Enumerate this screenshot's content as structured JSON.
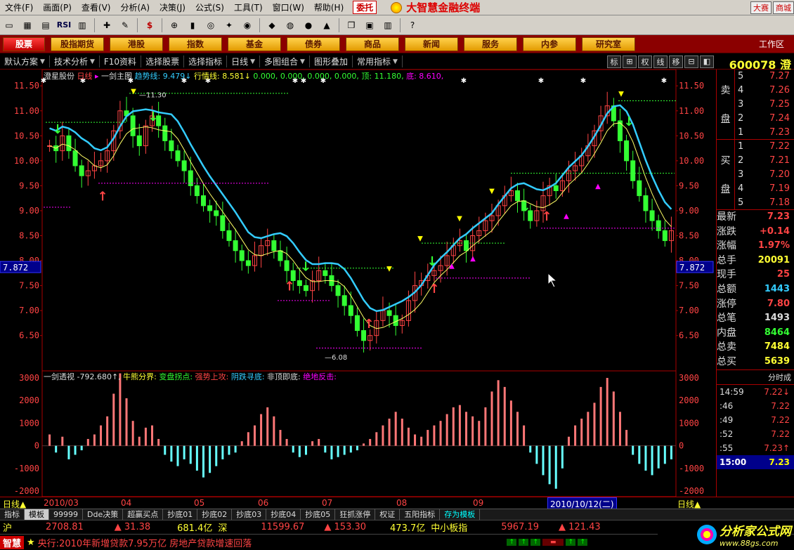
{
  "menu": {
    "items": [
      "文件(F)",
      "画面(P)",
      "查看(V)",
      "分析(A)",
      "决策(J)",
      "公式(S)",
      "工具(T)",
      "窗口(W)",
      "帮助(H)"
    ],
    "weituo": "委托",
    "brand": "大智慧金融终端",
    "right_buttons": [
      "大赛",
      "商城"
    ]
  },
  "toolbar": {
    "rsi_label": "RSI",
    "yuan": "$"
  },
  "nav": {
    "first": "股票",
    "items": [
      "股指期货",
      "港股",
      "指数",
      "基金",
      "债券",
      "商品",
      "新闻",
      "服务",
      "内参",
      "研究室"
    ],
    "work": "工作区"
  },
  "subbar": {
    "items": [
      "默认方案",
      "技术分析",
      "F10资料",
      "选择股票",
      "选择指标",
      "日线",
      "多图组合",
      "图形叠加",
      "常用指标"
    ],
    "controls": [
      "标",
      "⊞",
      "权",
      "线",
      "移",
      "⊟",
      "◧"
    ]
  },
  "stock_code": "600078 澄",
  "legend_main": {
    "name": "澄星股份",
    "period": "日线",
    "formula": "一剑主图",
    "trend_label": "趋势线:",
    "trend_value": "9.479↓",
    "hq_label": "行情线:",
    "hq_value": "8.581↓",
    "zeros": "0.000, 0.000, 0.000, 0.000,",
    "top_label": "顶:",
    "top_value": "11.180,",
    "bottom_label": "底:",
    "bottom_value": "8.610,"
  },
  "legend_sub": {
    "name": "一剑透视",
    "value": "-792.680↑,",
    "items": [
      "牛熊分界:",
      "变盘拐点:",
      "强势上攻:",
      "阴跌寻底:",
      "非顶即底:",
      "绝地反击:"
    ]
  },
  "price_axis": [
    "11.50",
    "11.00",
    "10.50",
    "10.00",
    "9.50",
    "9.00",
    "8.50",
    "8.00",
    "7.50",
    "7.00",
    "6.50"
  ],
  "sub_axis": [
    "3000",
    "2000",
    "1000",
    "0",
    "-1000",
    "-2000"
  ],
  "current_price_tag": "7.872",
  "annotations": {
    "high": "11.30",
    "low": "6.08"
  },
  "order_book": {
    "sell_label": [
      "卖",
      "盘"
    ],
    "buy_label": [
      "买",
      "盘"
    ],
    "sell": [
      {
        "n": "5",
        "p": "7.27"
      },
      {
        "n": "4",
        "p": "7.26"
      },
      {
        "n": "3",
        "p": "7.25"
      },
      {
        "n": "2",
        "p": "7.24"
      },
      {
        "n": "1",
        "p": "7.23"
      }
    ],
    "buy": [
      {
        "n": "1",
        "p": "7.22"
      },
      {
        "n": "2",
        "p": "7.21"
      },
      {
        "n": "3",
        "p": "7.20"
      },
      {
        "n": "4",
        "p": "7.19"
      },
      {
        "n": "5",
        "p": "7.18"
      }
    ]
  },
  "quote": [
    {
      "k": "最新",
      "v": "7.23",
      "c": "#ff4444"
    },
    {
      "k": "涨跌",
      "v": "+0.14",
      "c": "#ff4444"
    },
    {
      "k": "涨幅",
      "v": "1.97%",
      "c": "#ff4444"
    },
    {
      "k": "总手",
      "v": "20091",
      "c": "#ffff33"
    },
    {
      "k": "现手",
      "v": "25",
      "c": "#ff4444"
    },
    {
      "k": "总额",
      "v": "1443",
      "c": "#33ccff"
    },
    {
      "k": "涨停",
      "v": "7.80",
      "c": "#ff4444"
    },
    {
      "k": "总笔",
      "v": "1493",
      "c": "#dddddd"
    },
    {
      "k": "内盘",
      "v": "8464",
      "c": "#33ff33"
    },
    {
      "k": "总卖",
      "v": "7484",
      "c": "#ffff33"
    },
    {
      "k": "总买",
      "v": "5639",
      "c": "#ffff33"
    }
  ],
  "ticks_header": "分时成",
  "ticks": [
    {
      "t": "14:59",
      "p": "7.22↓"
    },
    {
      "t": ":46",
      "p": "7.22"
    },
    {
      "t": ":49",
      "p": "7.22"
    },
    {
      "t": ":52",
      "p": "7.22"
    },
    {
      "t": ":55",
      "p": "7.23↑"
    }
  ],
  "tick_last": {
    "t": "15:00",
    "p": "7.23"
  },
  "date_axis": {
    "left_label": "日线",
    "labels": [
      "2010/03",
      "04",
      "05",
      "06",
      "07",
      "08",
      "09",
      "10"
    ],
    "cursor_date": "2010/10/12(二)",
    "right_label": "日线"
  },
  "tabs": [
    "指标",
    "模板",
    "99999",
    "Dde决策",
    "超赢买点",
    "抄底01",
    "抄底02",
    "抄底03",
    "抄底04",
    "抄底05",
    "狂抓涨停",
    "权证",
    "五阳指标",
    "存为模板"
  ],
  "index_bar": {
    "sh_label": "沪",
    "sh_val": "2708.81",
    "sh_chg": "▲ 31.38",
    "sh_amt": "681.4亿",
    "sz_label": "深",
    "sz_val": "11599.67",
    "sz_chg": "▲ 153.30",
    "sz_amt": "473.7亿",
    "zx_label": "中小板指",
    "zx_val": "5967.19",
    "zx_chg": "▲ 121.43"
  },
  "ticker": {
    "brand": "智慧",
    "text": "央行:2010年新增贷款7.95万亿 房地产贷款增速回落"
  },
  "watermark": {
    "t1": "分析家公式网",
    "t2": "www.88gs.com"
  },
  "colors": {
    "up": "#ff4444",
    "down": "#33ff33",
    "trend": "#33ccff",
    "axis": "#aa0000"
  },
  "chart_data": {
    "type": "candlestick",
    "title": "一剑主图",
    "ylim": [
      6.2,
      11.7
    ],
    "x_labels": [
      "2010/03",
      "04",
      "05",
      "06",
      "07",
      "08",
      "09",
      "10"
    ],
    "close": [
      10.3,
      10.2,
      10.5,
      10.2,
      9.9,
      9.7,
      9.8,
      9.9,
      10.0,
      10.2,
      10.6,
      11.0,
      10.9,
      10.5,
      10.3,
      10.7,
      10.9,
      10.7,
      10.4,
      10.2,
      10.0,
      9.8,
      9.5,
      9.3,
      9.1,
      9.0,
      8.9,
      8.6,
      8.4,
      8.2,
      8.0,
      7.9,
      8.1,
      8.3,
      8.4,
      8.2,
      8.0,
      7.8,
      7.6,
      7.5,
      7.4,
      7.6,
      7.8,
      7.7,
      7.5,
      7.3,
      7.1,
      6.9,
      6.6,
      6.4,
      6.5,
      6.8,
      7.0,
      6.9,
      6.7,
      6.8,
      7.2,
      7.5,
      7.6,
      7.7,
      7.8,
      7.9,
      8.1,
      8.3,
      8.4,
      8.2,
      8.5,
      8.6,
      8.8,
      8.9,
      9.1,
      9.3,
      9.4,
      9.2,
      9.0,
      8.8,
      9.0,
      9.3,
      9.5,
      9.4,
      9.6,
      9.8,
      9.9,
      10.1,
      10.3,
      10.6,
      10.9,
      11.1,
      10.8,
      10.4,
      10.0,
      9.6,
      9.3,
      9.0,
      8.8,
      8.6,
      8.4,
      8.6
    ],
    "volume_indicator": [
      500,
      -300,
      400,
      -600,
      -400,
      -200,
      300,
      500,
      900,
      1300,
      2300,
      3200,
      2100,
      1100,
      400,
      800,
      900,
      300,
      -400,
      -700,
      -900,
      -600,
      -800,
      -1100,
      -1400,
      -1200,
      -900,
      -600,
      -400,
      -300,
      200,
      600,
      900,
      1400,
      1700,
      1300,
      700,
      300,
      -300,
      -500,
      -400,
      200,
      300,
      -300,
      -600,
      -500,
      -400,
      -300,
      -200,
      100,
      300,
      600,
      900,
      1200,
      1500,
      1200,
      800,
      500,
      400,
      700,
      900,
      1100,
      1400,
      1700,
      1800,
      1500,
      1300,
      1100,
      1700,
      2400,
      2900,
      2600,
      2000,
      1500,
      900,
      -300,
      -800,
      -1300,
      -1700,
      -1900,
      -1000,
      400,
      900,
      1200,
      1500,
      1900,
      2600,
      3000,
      2400,
      1500,
      700,
      -400,
      -800,
      -1100,
      -1300,
      -1000,
      -800,
      -600
    ],
    "trend_line_last": 9.479,
    "hq_line_last": 8.581,
    "top": 11.18,
    "bottom": 8.61
  }
}
